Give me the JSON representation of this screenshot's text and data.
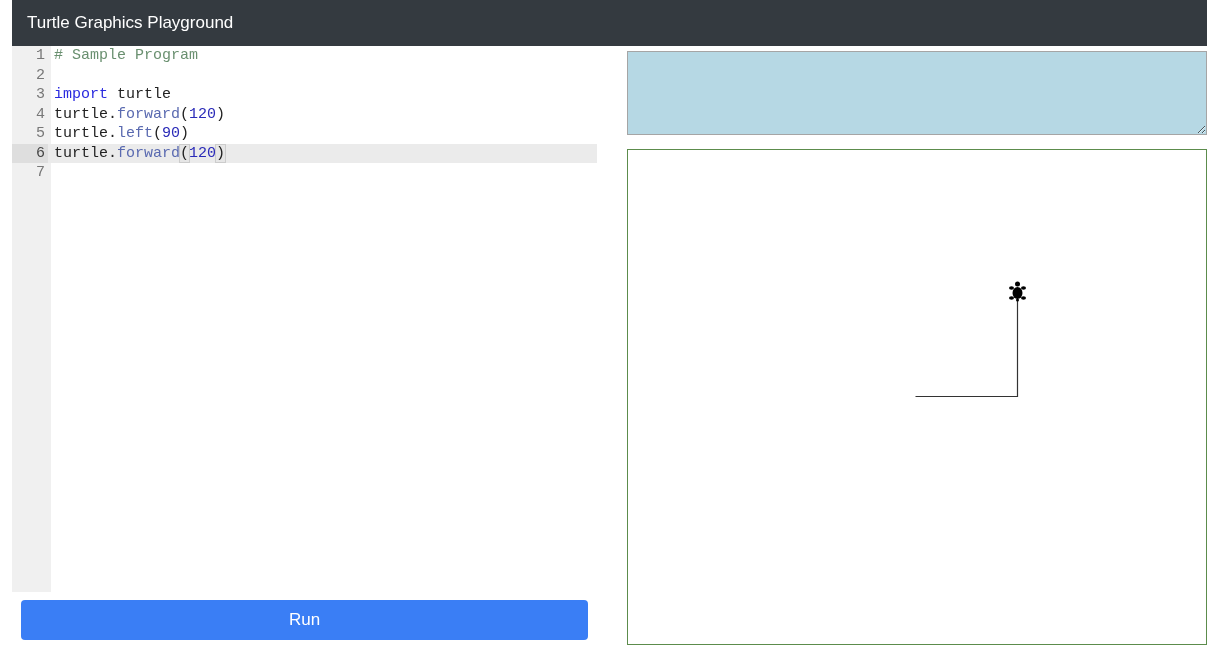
{
  "navbar": {
    "title": "Turtle Graphics Playground"
  },
  "editor": {
    "lines": [
      {
        "number": "1",
        "selected": false,
        "tokens": [
          {
            "kind": "comment",
            "text": "# Sample Program"
          }
        ]
      },
      {
        "number": "2",
        "selected": false
      },
      {
        "number": "3",
        "selected": false,
        "tokens": [
          {
            "kind": "keyword",
            "text": "import"
          },
          {
            "kind": "plain",
            "text": " turtle"
          }
        ]
      },
      {
        "number": "4",
        "selected": false,
        "tokens": [
          {
            "kind": "plain",
            "text": "turtle."
          },
          {
            "kind": "property",
            "text": "forward"
          },
          {
            "kind": "plain",
            "text": "("
          },
          {
            "kind": "number",
            "text": "120"
          },
          {
            "kind": "plain",
            "text": ")"
          }
        ]
      },
      {
        "number": "5",
        "selected": false,
        "tokens": [
          {
            "kind": "plain",
            "text": "turtle."
          },
          {
            "kind": "property",
            "text": "left"
          },
          {
            "kind": "plain",
            "text": "("
          },
          {
            "kind": "number",
            "text": "90"
          },
          {
            "kind": "plain",
            "text": ")"
          }
        ]
      },
      {
        "number": "6",
        "selected": true,
        "tokens": [
          {
            "kind": "plain",
            "text": "turtle."
          },
          {
            "kind": "property",
            "text": "forward"
          },
          {
            "kind": "bracket",
            "text": "("
          },
          {
            "kind": "number",
            "text": "120"
          },
          {
            "kind": "bracket",
            "text": ")"
          }
        ]
      },
      {
        "number": "7",
        "selected": false
      }
    ]
  },
  "run_button": {
    "label": "Run"
  },
  "canvas": {
    "kind": "turtle"
  }
}
